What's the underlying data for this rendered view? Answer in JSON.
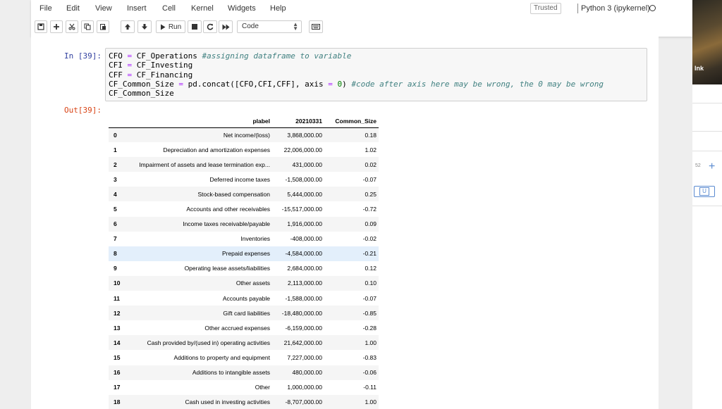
{
  "menu": [
    "File",
    "Edit",
    "View",
    "Insert",
    "Cell",
    "Kernel",
    "Widgets",
    "Help"
  ],
  "trusted": "Trusted",
  "kernel": "Python 3 (ipykernel)",
  "toolbar": {
    "run_label": "Run",
    "cell_type": "Code"
  },
  "background_window": {
    "label": "Ink",
    "number": "52"
  },
  "input_cell": {
    "prompt": "In [39]:",
    "code": [
      "CFO = CF_Operations #assigning dataframe to variable",
      "CFI = CF_Investing",
      "CFF = CF_Financing",
      "CF_Common_Size = pd.concat([CFO,CFI,CFF], axis = 0) #code after axis here may be wrong, the 0 may be wrong",
      "CF_Common_Size"
    ]
  },
  "output_cell": {
    "prompt": "Out[39]:",
    "columns": [
      "",
      "plabel",
      "20210331",
      "Common_Size"
    ],
    "rows": [
      [
        "0",
        "Net income/(loss)",
        "3,868,000.00",
        "0.18"
      ],
      [
        "1",
        "Depreciation and amortization expenses",
        "22,006,000.00",
        "1.02"
      ],
      [
        "2",
        "Impairment of assets and lease termination exp...",
        "431,000.00",
        "0.02"
      ],
      [
        "3",
        "Deferred income taxes",
        "-1,508,000.00",
        "-0.07"
      ],
      [
        "4",
        "Stock-based compensation",
        "5,444,000.00",
        "0.25"
      ],
      [
        "5",
        "Accounts and other receivables",
        "-15,517,000.00",
        "-0.72"
      ],
      [
        "6",
        "Income taxes receivable/payable",
        "1,916,000.00",
        "0.09"
      ],
      [
        "7",
        "Inventories",
        "-408,000.00",
        "-0.02"
      ],
      [
        "8",
        "Prepaid expenses",
        "-4,584,000.00",
        "-0.21"
      ],
      [
        "9",
        "Operating lease assets/liabilities",
        "2,684,000.00",
        "0.12"
      ],
      [
        "10",
        "Other assets",
        "2,113,000.00",
        "0.10"
      ],
      [
        "11",
        "Accounts payable",
        "-1,588,000.00",
        "-0.07"
      ],
      [
        "12",
        "Gift card liabilities",
        "-18,480,000.00",
        "-0.85"
      ],
      [
        "13",
        "Other accrued expenses",
        "-6,159,000.00",
        "-0.28"
      ],
      [
        "14",
        "Cash provided by/(used in) operating activities",
        "21,642,000.00",
        "1.00"
      ],
      [
        "15",
        "Additions to property and equipment",
        "7,227,000.00",
        "-0.83"
      ],
      [
        "16",
        "Additions to intangible assets",
        "480,000.00",
        "-0.06"
      ],
      [
        "17",
        "Other",
        "1,000,000.00",
        "-0.11"
      ],
      [
        "18",
        "Cash used in investing activities",
        "-8,707,000.00",
        "1.00"
      ]
    ],
    "highlighted_row": 8
  }
}
